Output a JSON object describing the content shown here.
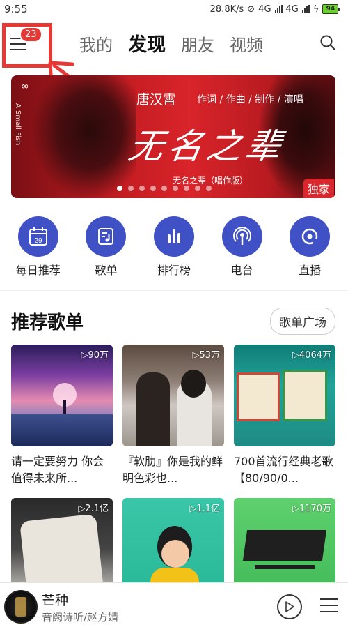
{
  "status_bar": {
    "time": "9:55",
    "net_speed": "28.8K/s",
    "network_1": "4G",
    "network_2": "4G",
    "battery": "94"
  },
  "nav": {
    "badge": "23",
    "tabs": [
      {
        "label": "我的",
        "active": false
      },
      {
        "label": "发现",
        "active": true
      },
      {
        "label": "朋友",
        "active": false
      },
      {
        "label": "视频",
        "active": false
      }
    ]
  },
  "banner": {
    "artist": "唐汉霄",
    "roles": "作词 / 作曲 / 制作 / 演唱",
    "headline": "无名之辈",
    "side_text": "A Small Fish",
    "caption": "无名之辈（唱作版）",
    "tag": "独家",
    "dots": 9,
    "active_dot": 0
  },
  "quick_links": [
    {
      "label": "每日推荐",
      "icon": "calendar-icon",
      "day": "29"
    },
    {
      "label": "歌单",
      "icon": "playlist-icon"
    },
    {
      "label": "排行榜",
      "icon": "chart-bars-icon"
    },
    {
      "label": "电台",
      "icon": "radio-icon"
    },
    {
      "label": "直播",
      "icon": "live-icon"
    }
  ],
  "section": {
    "title": "推荐歌单",
    "more": "歌单广场"
  },
  "playlists": [
    {
      "count": "▷90万",
      "title": "请一定要努力 你会值得未来所..."
    },
    {
      "count": "▷53万",
      "title": "『软肋』你是我的鲜明色彩也..."
    },
    {
      "count": "▷4064万",
      "title": "700首流行经典老歌【80/90/0..."
    },
    {
      "count": "▷2.1亿",
      "title": ""
    },
    {
      "count": "▷1.1亿",
      "title": ""
    },
    {
      "count": "▷1170万",
      "title": ""
    }
  ],
  "player": {
    "song": "芒种",
    "artist": "音阙诗听/赵方婧"
  }
}
